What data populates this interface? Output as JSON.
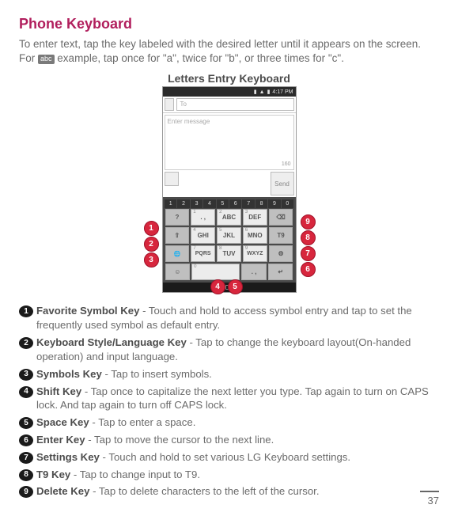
{
  "title": "Phone Keyboard",
  "intro_pre": "To enter text, tap the key labeled with the desired letter until it appears on the screen. For ",
  "abc": "abc",
  "intro_post": " example, tap once for \"a\", twice for \"b\", or three times for \"c\".",
  "caption": "Letters Entry Keyboard",
  "phone": {
    "time": "4:17 PM",
    "to": "To",
    "msg_ph": "Enter message",
    "count": "160",
    "send": "Send",
    "digits": [
      "1",
      "2",
      "3",
      "4",
      "5",
      "6",
      "7",
      "8",
      "9",
      "0"
    ],
    "r1": [
      {
        "sup": "",
        "lbl": "?",
        "cls": "dark"
      },
      {
        "sup": "1",
        "lbl": ". ,",
        "cls": ""
      },
      {
        "sup": "2",
        "lbl": "ABC",
        "cls": ""
      },
      {
        "sup": "3",
        "lbl": "DEF",
        "cls": ""
      },
      {
        "sup": "",
        "lbl": "⌫",
        "cls": "dark"
      }
    ],
    "r2": [
      {
        "sup": "",
        "lbl": "⇧",
        "cls": "dark"
      },
      {
        "sup": "4",
        "lbl": "GHI",
        "cls": ""
      },
      {
        "sup": "5",
        "lbl": "JKL",
        "cls": ""
      },
      {
        "sup": "6",
        "lbl": "MNO",
        "cls": ""
      },
      {
        "sup": "",
        "lbl": "T9",
        "cls": "dark"
      }
    ],
    "r3": [
      {
        "sup": "",
        "lbl": "🌐",
        "cls": "dark small"
      },
      {
        "sup": "7",
        "lbl": "PQRS",
        "cls": "small"
      },
      {
        "sup": "8",
        "lbl": "TUV",
        "cls": ""
      },
      {
        "sup": "9",
        "lbl": "WXYZ",
        "cls": "small"
      },
      {
        "sup": "",
        "lbl": "⚙",
        "cls": "dark"
      }
    ],
    "r4": [
      {
        "sup": "",
        "lbl": "☺",
        "cls": "dark",
        "w": "w1"
      },
      {
        "sup": "0",
        "lbl": " ",
        "cls": "",
        "w": "w2"
      },
      {
        "sup": "",
        "lbl": ". ,",
        "cls": "dark",
        "w": "w1"
      },
      {
        "sup": "",
        "lbl": "↵",
        "cls": "dark",
        "w": "w1"
      }
    ]
  },
  "bubbles": [
    "1",
    "2",
    "3",
    "4",
    "5",
    "6",
    "7",
    "8",
    "9"
  ],
  "items": [
    {
      "n": "1",
      "b": "Favorite Symbol Key",
      "t": " - Touch and hold to access symbol entry and tap to set the frequently used symbol as default entry."
    },
    {
      "n": "2",
      "b": "Keyboard Style/Language Key",
      "t": " - Tap to change the keyboard layout(On-handed operation) and input language."
    },
    {
      "n": "3",
      "b": "Symbols Key",
      "t": " - Tap to insert symbols."
    },
    {
      "n": "4",
      "b": "Shift Key",
      "t": " - Tap once to capitalize the next letter you type. Tap again to turn on CAPS lock. And tap again to turn off CAPS lock."
    },
    {
      "n": "5",
      "b": "Space Key",
      "t": " - Tap to enter a space."
    },
    {
      "n": "6",
      "b": "Enter Key",
      "t": " - Tap to move the cursor to the next line."
    },
    {
      "n": "7",
      "b": "Settings Key",
      "t": " - Touch and hold to set various LG Keyboard settings."
    },
    {
      "n": "8",
      "b": "T9 Key",
      "t": " - Tap to change input to T9."
    },
    {
      "n": "9",
      "b": "Delete Key",
      "t": " - Tap to delete characters to the left of the cursor."
    }
  ],
  "page": "37"
}
